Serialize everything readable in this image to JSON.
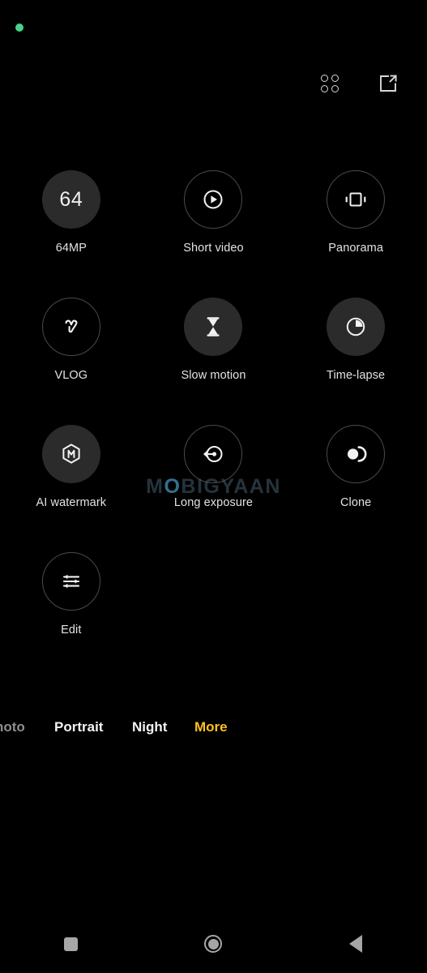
{
  "status_bar": {
    "privacy_indicator": "camera-in-use-dot",
    "privacy_color": "#45d48a"
  },
  "top_toolbar": {
    "items": [
      {
        "name": "grid-icon",
        "label": "Modes grid"
      },
      {
        "name": "edit-square-icon",
        "label": "Edit modes"
      }
    ]
  },
  "modes": [
    {
      "label": "64MP",
      "icon": "64mp-icon",
      "badge_text": "64",
      "style": "filled"
    },
    {
      "label": "Short video",
      "icon": "short-video-icon",
      "badge_text": "",
      "style": "outlined"
    },
    {
      "label": "Panorama",
      "icon": "panorama-icon",
      "badge_text": "",
      "style": "outlined"
    },
    {
      "label": "VLOG",
      "icon": "vlog-icon",
      "badge_text": "",
      "style": "outlined"
    },
    {
      "label": "Slow motion",
      "icon": "slow-motion-icon",
      "badge_text": "",
      "style": "filled"
    },
    {
      "label": "Time-lapse",
      "icon": "time-lapse-icon",
      "badge_text": "",
      "style": "filled"
    },
    {
      "label": "AI watermark",
      "icon": "ai-watermark-icon",
      "badge_text": "",
      "style": "filled"
    },
    {
      "label": "Long exposure",
      "icon": "long-exposure-icon",
      "badge_text": "",
      "style": "outlined"
    },
    {
      "label": "Clone",
      "icon": "clone-icon",
      "badge_text": "",
      "style": "outlined"
    },
    {
      "label": "Edit",
      "icon": "edit-tune-icon",
      "badge_text": "",
      "style": "outlined"
    }
  ],
  "watermark": {
    "text_before": "M",
    "text_o": "O",
    "text_after": "BIGYAAN",
    "full_text": "MOBIGYAAN"
  },
  "mode_strip": {
    "tabs": [
      {
        "label": "hoto",
        "state": "partial"
      },
      {
        "label": "Portrait",
        "state": "inactive"
      },
      {
        "label": "Night",
        "state": "inactive"
      },
      {
        "label": "More",
        "state": "active"
      }
    ],
    "active_color": "#fcc21b"
  },
  "nav_bar": {
    "buttons": [
      {
        "name": "recents-button",
        "label": "Recent apps"
      },
      {
        "name": "home-button",
        "label": "Home"
      },
      {
        "name": "back-button",
        "label": "Back"
      }
    ],
    "icon_color": "#a6a6a6"
  }
}
